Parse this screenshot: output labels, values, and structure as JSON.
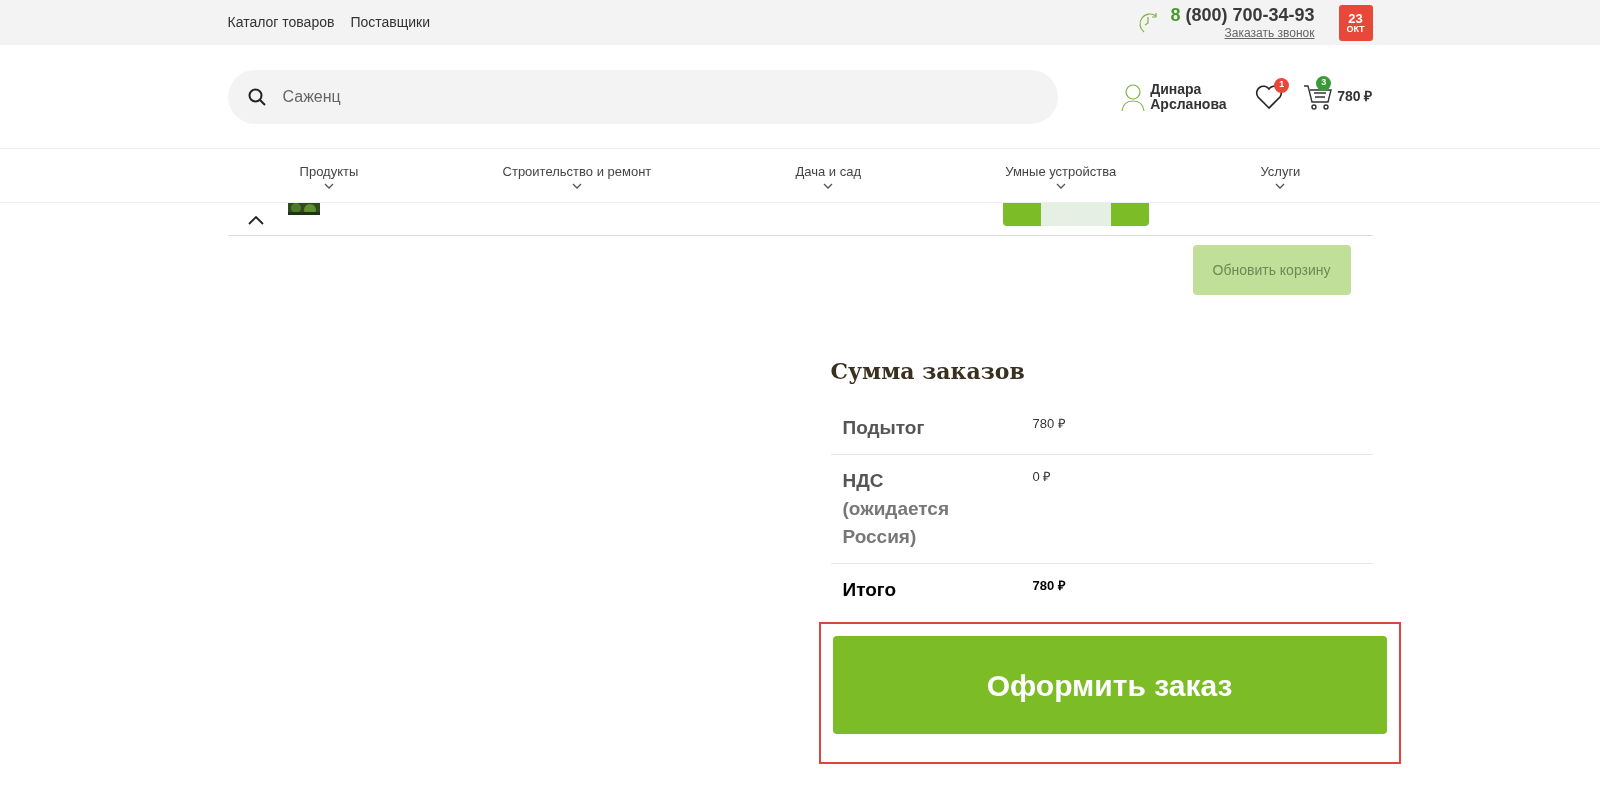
{
  "top_bar": {
    "links": [
      "Каталог товаров",
      "Поставщики"
    ],
    "phone_prefix": "8",
    "phone": "(800) 700-34-93",
    "callback_link": "Заказать звонок",
    "date_day": "23",
    "date_month": "ОКТ"
  },
  "header": {
    "search": {
      "value": "Саженц"
    },
    "user_name": "Динара Арсланова",
    "favorites_count": "1",
    "cart_count": "3",
    "cart_total": "780 ₽"
  },
  "nav": [
    {
      "label": "Продукты"
    },
    {
      "label": "Строительство и ремонт"
    },
    {
      "label": "Дача и сад"
    },
    {
      "label": "Умные устройства"
    },
    {
      "label": "Услуги"
    }
  ],
  "cart": {
    "update_button": {
      "label": "Обновить корзину",
      "disabled": true
    }
  },
  "totals": {
    "title": "Сумма заказов",
    "rows": [
      {
        "label": "Подытог",
        "value": "780 ₽",
        "kind": "plain"
      },
      {
        "label": "НДС",
        "note": "(ожидается Россия)",
        "value": "0 ₽",
        "kind": "tax"
      },
      {
        "label": "Итого",
        "value": "780 ₽",
        "kind": "total"
      }
    ]
  },
  "checkout_button": {
    "label": "Оформить заказ",
    "highlighted": true
  }
}
